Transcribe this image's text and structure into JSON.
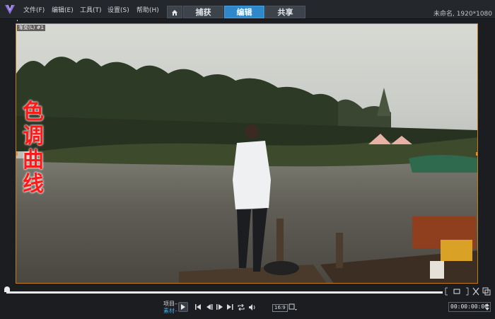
{
  "app": {
    "menu": [
      "文件(F)",
      "编辑(E)",
      "工具(T)",
      "设置(S)",
      "帮助(H)"
    ],
    "tabs": [
      "捕获",
      "编辑",
      "共享"
    ],
    "active_tab": "编辑",
    "project_info": "未命名, 1920*1080"
  },
  "preview": {
    "clip_label": "渐变(L) #1",
    "overlay_text": "色调曲线"
  },
  "playback": {
    "mode_project": "项目",
    "mode_clip": "素材",
    "aspect_ratio": "16:9",
    "timecode": "00:00:00:00"
  },
  "colors": {
    "accent": "#2f88c9",
    "selection_border": "#c47a1e",
    "overlay_text": "#ff1a1a"
  },
  "icons": [
    "home-icon",
    "play-icon",
    "go-start-icon",
    "prev-frame-icon",
    "next-frame-icon",
    "go-end-icon",
    "repeat-icon",
    "volume-icon",
    "mark-in-icon",
    "mark-out-icon",
    "cut-icon",
    "expand-icon"
  ]
}
